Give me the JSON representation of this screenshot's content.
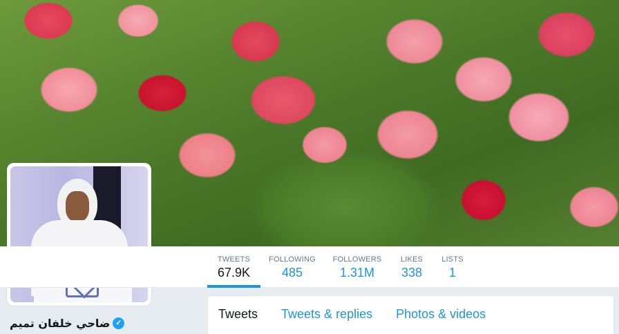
{
  "profile": {
    "name": "ضاحي خلفان تميم",
    "verified": true
  },
  "stats": [
    {
      "label": "TWEETS",
      "value": "67.9K",
      "active": true
    },
    {
      "label": "FOLLOWING",
      "value": "485",
      "active": false
    },
    {
      "label": "FOLLOWERS",
      "value": "1.31M",
      "active": false
    },
    {
      "label": "LIKES",
      "value": "338",
      "active": false
    },
    {
      "label": "LISTS",
      "value": "1",
      "active": false
    }
  ],
  "timeline_tabs": [
    {
      "label": "Tweets",
      "active": true
    },
    {
      "label": "Tweets & replies",
      "active": false
    },
    {
      "label": "Photos & videos",
      "active": false
    }
  ],
  "colors": {
    "accent": "#1b95e0",
    "text": "#14171a",
    "muted": "#657786",
    "verified": "#1da1f2"
  }
}
